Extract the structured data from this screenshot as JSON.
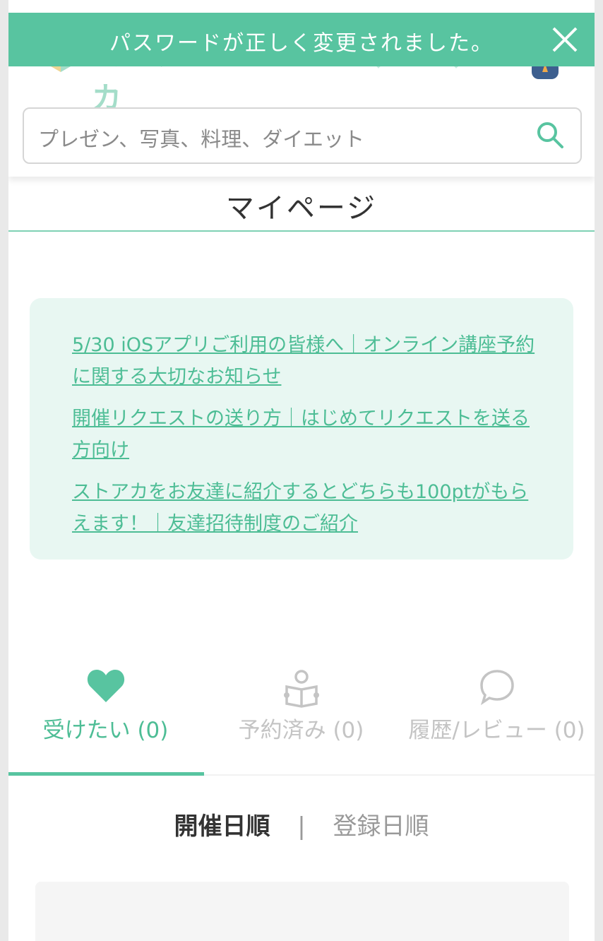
{
  "header": {
    "logo_text": "ストアカ",
    "search": {
      "placeholder": "プレゼン、写真、料理、ダイエット"
    }
  },
  "toast": {
    "message": "パスワードが正しく変更されました。",
    "close_icon": "close-icon"
  },
  "page": {
    "title": "マイページ"
  },
  "notices": [
    "5/30 iOSアプリご利用の皆様へ｜オンライン講座予約に関する大切なお知らせ",
    "開催リクエストの送り方｜はじめてリクエストを送る方向け",
    "ストアカをお友達に紹介するとどちらも100ptがもらえます！｜友達招待制度のご紹介"
  ],
  "tabs": [
    {
      "label": "受けたい (0)",
      "icon": "heart-icon",
      "active": true
    },
    {
      "label": "予約済み (0)",
      "icon": "reading-person-icon",
      "active": false
    },
    {
      "label": "履歴/レビュー (0)",
      "icon": "speech-bubble-icon",
      "active": false
    }
  ],
  "sort": {
    "active": "開催日順",
    "separator": "|",
    "inactive": "登録日順"
  },
  "colors": {
    "accent": "#58c4a0",
    "link": "#4dbd95",
    "notice_bg": "#e8f7f2",
    "inactive": "#c4c4c4"
  }
}
